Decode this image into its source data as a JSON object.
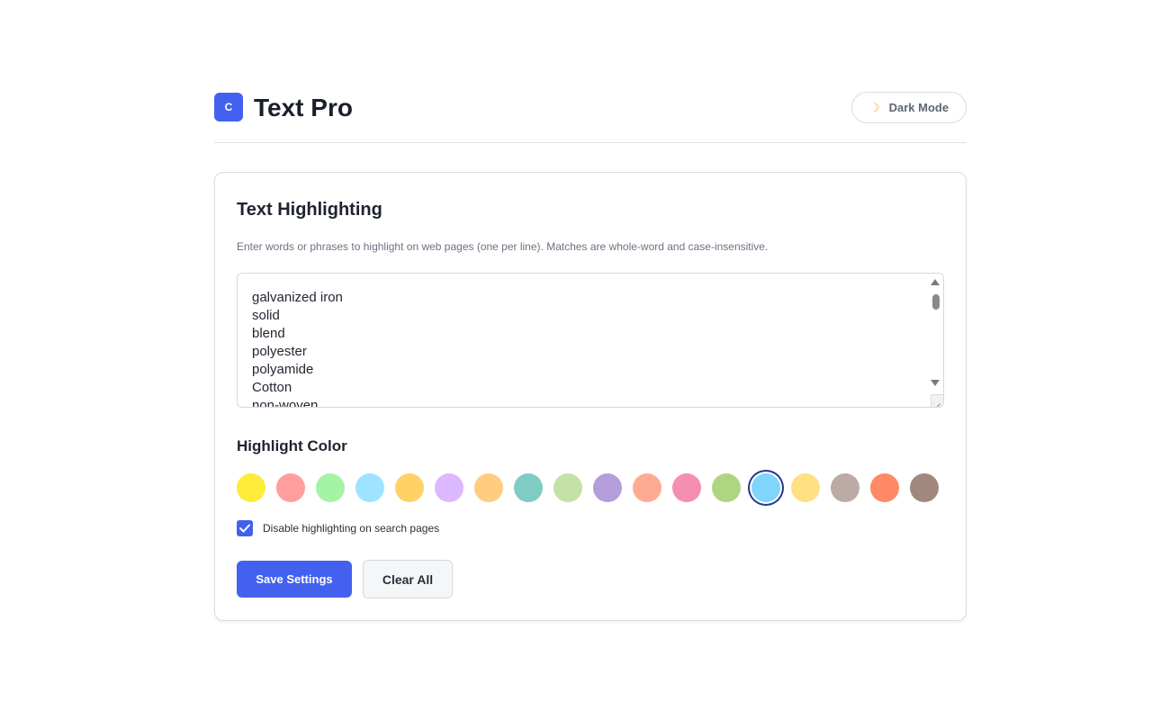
{
  "header": {
    "logo_letter": "C",
    "title": "Text Pro",
    "dark_mode_icon": "moon-icon",
    "dark_mode_label": "Dark Mode"
  },
  "card": {
    "title": "Text Highlighting",
    "description": "Enter words or phrases to highlight on web pages (one per line). Matches are whole-word and case-insensitive.",
    "terms": [
      "galvanized iron",
      "solid",
      "blend",
      "polyester",
      "polyamide",
      "Cotton",
      "non-woven"
    ]
  },
  "colors": {
    "section_title": "Highlight Color",
    "swatches": [
      "#ffeb3b",
      "#ff9e9e",
      "#a5f3a5",
      "#9ee3ff",
      "#ffd166",
      "#dcb8ff",
      "#ffcc80",
      "#80cbc4",
      "#c5e1a5",
      "#b39ddb",
      "#ffab91",
      "#f48fb1",
      "#aed581",
      "#81d4fa",
      "#ffe082",
      "#bcaaa4",
      "#ff8a65",
      "#a1887f"
    ],
    "selected_index": 13,
    "selected_ring": "#1e3a8a"
  },
  "options": {
    "disable_search_label": "Disable highlighting on search pages",
    "disable_search_checked": true
  },
  "buttons": {
    "save_label": "Save Settings",
    "clear_label": "Clear All"
  },
  "theme": {
    "accent": "#4361ee"
  }
}
